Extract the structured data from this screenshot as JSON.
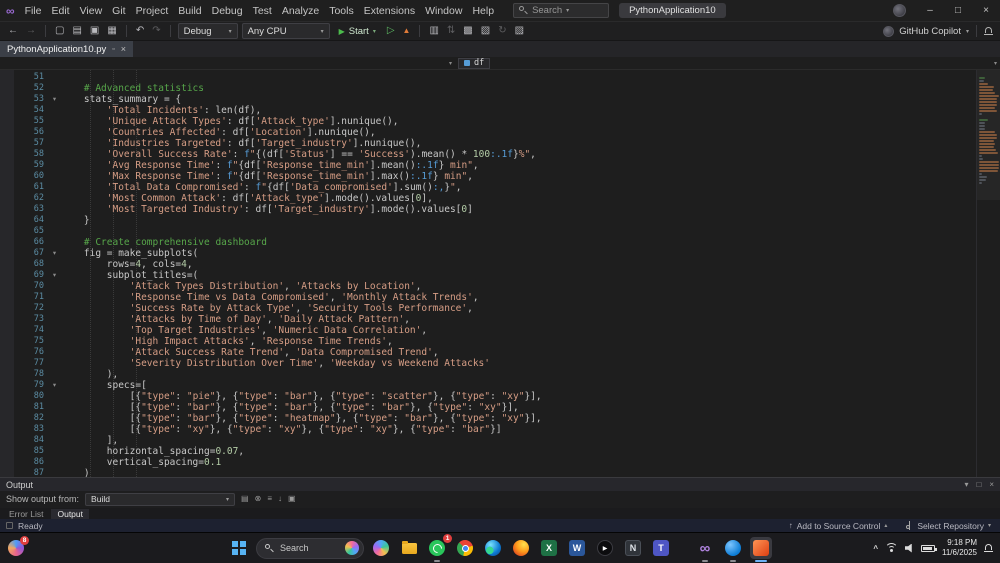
{
  "window": {
    "menu": [
      "File",
      "Edit",
      "View",
      "Git",
      "Project",
      "Build",
      "Debug",
      "Test",
      "Analyze",
      "Tools",
      "Extensions",
      "Window",
      "Help"
    ],
    "search_label": "Search",
    "title": "PythonApplication10"
  },
  "toolbar": {
    "config": "Debug",
    "platform": "Any CPU",
    "start": "Start",
    "copilot": "GitHub Copilot"
  },
  "tabbar": {
    "active_tab": "PythonApplication10.py"
  },
  "navbar": {
    "symbol": "df"
  },
  "editor": {
    "lines": [
      {
        "no": 51,
        "t": []
      },
      {
        "no": 52,
        "t": [
          [
            "p",
            "    "
          ],
          [
            "c",
            "# Advanced statistics"
          ]
        ]
      },
      {
        "no": 53,
        "fold": true,
        "t": [
          [
            "p",
            "    stats_summary = {"
          ]
        ]
      },
      {
        "no": 54,
        "t": [
          [
            "p",
            "        "
          ],
          [
            "s",
            "'Total Incidents'"
          ],
          [
            "p",
            ": len(df),"
          ]
        ]
      },
      {
        "no": 55,
        "t": [
          [
            "p",
            "        "
          ],
          [
            "s",
            "'Unique Attack Types'"
          ],
          [
            "p",
            ": df["
          ],
          [
            "s",
            "'Attack_type'"
          ],
          [
            "p",
            "].nunique(),"
          ]
        ]
      },
      {
        "no": 56,
        "t": [
          [
            "p",
            "        "
          ],
          [
            "s",
            "'Countries Affected'"
          ],
          [
            "p",
            ": df["
          ],
          [
            "s",
            "'Location'"
          ],
          [
            "p",
            "].nunique(),"
          ]
        ]
      },
      {
        "no": 57,
        "t": [
          [
            "p",
            "        "
          ],
          [
            "s",
            "'Industries Targeted'"
          ],
          [
            "p",
            ": df["
          ],
          [
            "s",
            "'Target_industry'"
          ],
          [
            "p",
            "].nunique(),"
          ]
        ]
      },
      {
        "no": 58,
        "t": [
          [
            "p",
            "        "
          ],
          [
            "s",
            "'Overall Success Rate'"
          ],
          [
            "p",
            ": "
          ],
          [
            "k",
            "f"
          ],
          [
            "s",
            "\""
          ],
          [
            "p",
            "{(df["
          ],
          [
            "s",
            "'Status'"
          ],
          [
            "p",
            "] == "
          ],
          [
            "s",
            "'Success'"
          ],
          [
            "p",
            ").mean() * "
          ],
          [
            "n",
            "100"
          ],
          [
            "f",
            ":.1f"
          ],
          [
            "p",
            "}"
          ],
          [
            "s",
            "%\""
          ],
          [
            "p",
            ","
          ]
        ]
      },
      {
        "no": 59,
        "t": [
          [
            "p",
            "        "
          ],
          [
            "s",
            "'Avg Response Time'"
          ],
          [
            "p",
            ": "
          ],
          [
            "k",
            "f"
          ],
          [
            "s",
            "\""
          ],
          [
            "p",
            "{df["
          ],
          [
            "s",
            "'Response_time_min'"
          ],
          [
            "p",
            "].mean()"
          ],
          [
            "f",
            ":.1f"
          ],
          [
            "p",
            "}"
          ],
          [
            "s",
            " min\""
          ],
          [
            "p",
            ","
          ]
        ]
      },
      {
        "no": 60,
        "t": [
          [
            "p",
            "        "
          ],
          [
            "s",
            "'Max Response Time'"
          ],
          [
            "p",
            ": "
          ],
          [
            "k",
            "f"
          ],
          [
            "s",
            "\""
          ],
          [
            "p",
            "{df["
          ],
          [
            "s",
            "'Response_time_min'"
          ],
          [
            "p",
            "].max()"
          ],
          [
            "f",
            ":.1f"
          ],
          [
            "p",
            "}"
          ],
          [
            "s",
            " min\""
          ],
          [
            "p",
            ","
          ]
        ]
      },
      {
        "no": 61,
        "t": [
          [
            "p",
            "        "
          ],
          [
            "s",
            "'Total Data Compromised'"
          ],
          [
            "p",
            ": "
          ],
          [
            "k",
            "f"
          ],
          [
            "s",
            "\""
          ],
          [
            "p",
            "{df["
          ],
          [
            "s",
            "'Data_compromised'"
          ],
          [
            "p",
            "].sum()"
          ],
          [
            "f",
            ":,"
          ],
          [
            "p",
            "}"
          ],
          [
            "s",
            "\""
          ],
          [
            "p",
            ","
          ]
        ]
      },
      {
        "no": 62,
        "t": [
          [
            "p",
            "        "
          ],
          [
            "s",
            "'Most Common Attack'"
          ],
          [
            "p",
            ": df["
          ],
          [
            "s",
            "'Attack_type'"
          ],
          [
            "p",
            "].mode().values["
          ],
          [
            "n",
            "0"
          ],
          [
            "p",
            "],"
          ]
        ]
      },
      {
        "no": 63,
        "t": [
          [
            "p",
            "        "
          ],
          [
            "s",
            "'Most Targeted Industry'"
          ],
          [
            "p",
            ": df["
          ],
          [
            "s",
            "'Target_industry'"
          ],
          [
            "p",
            "].mode().values["
          ],
          [
            "n",
            "0"
          ],
          [
            "p",
            "]"
          ]
        ]
      },
      {
        "no": 64,
        "t": [
          [
            "p",
            "    }"
          ]
        ]
      },
      {
        "no": 65,
        "t": []
      },
      {
        "no": 66,
        "t": [
          [
            "p",
            "    "
          ],
          [
            "c",
            "# Create comprehensive dashboard"
          ]
        ]
      },
      {
        "no": 67,
        "fold": true,
        "t": [
          [
            "p",
            "    fig = make_subplots("
          ]
        ]
      },
      {
        "no": 68,
        "t": [
          [
            "p",
            "        rows="
          ],
          [
            "n",
            "4"
          ],
          [
            "p",
            ", cols="
          ],
          [
            "n",
            "4"
          ],
          [
            "p",
            ","
          ]
        ]
      },
      {
        "no": 69,
        "fold": true,
        "t": [
          [
            "p",
            "        subplot_titles=("
          ]
        ]
      },
      {
        "no": 70,
        "t": [
          [
            "p",
            "            "
          ],
          [
            "s",
            "'Attack Types Distribution'"
          ],
          [
            "p",
            ", "
          ],
          [
            "s",
            "'Attacks by Location'"
          ],
          [
            "p",
            ","
          ]
        ]
      },
      {
        "no": 71,
        "t": [
          [
            "p",
            "            "
          ],
          [
            "s",
            "'Response Time vs Data Compromised'"
          ],
          [
            "p",
            ", "
          ],
          [
            "s",
            "'Monthly Attack Trends'"
          ],
          [
            "p",
            ","
          ]
        ]
      },
      {
        "no": 72,
        "t": [
          [
            "p",
            "            "
          ],
          [
            "s",
            "'Success Rate by Attack Type'"
          ],
          [
            "p",
            ", "
          ],
          [
            "s",
            "'Security Tools Performance'"
          ],
          [
            "p",
            ","
          ]
        ]
      },
      {
        "no": 73,
        "t": [
          [
            "p",
            "            "
          ],
          [
            "s",
            "'Attacks by Time of Day'"
          ],
          [
            "p",
            ", "
          ],
          [
            "s",
            "'Daily Attack Pattern'"
          ],
          [
            "p",
            ","
          ]
        ]
      },
      {
        "no": 74,
        "t": [
          [
            "p",
            "            "
          ],
          [
            "s",
            "'Top Target Industries'"
          ],
          [
            "p",
            ", "
          ],
          [
            "s",
            "'Numeric Data Correlation'"
          ],
          [
            "p",
            ","
          ]
        ]
      },
      {
        "no": 75,
        "t": [
          [
            "p",
            "            "
          ],
          [
            "s",
            "'High Impact Attacks'"
          ],
          [
            "p",
            ", "
          ],
          [
            "s",
            "'Response Time Trends'"
          ],
          [
            "p",
            ","
          ]
        ]
      },
      {
        "no": 76,
        "t": [
          [
            "p",
            "            "
          ],
          [
            "s",
            "'Attack Success Rate Trend'"
          ],
          [
            "p",
            ", "
          ],
          [
            "s",
            "'Data Compromised Trend'"
          ],
          [
            "p",
            ","
          ]
        ]
      },
      {
        "no": 77,
        "t": [
          [
            "p",
            "            "
          ],
          [
            "s",
            "'Severity Distribution Over Time'"
          ],
          [
            "p",
            ", "
          ],
          [
            "s",
            "'Weekday vs Weekend Attacks'"
          ]
        ]
      },
      {
        "no": 78,
        "t": [
          [
            "p",
            "        ),"
          ]
        ]
      },
      {
        "no": 79,
        "fold": true,
        "t": [
          [
            "p",
            "        specs=["
          ]
        ]
      },
      {
        "no": 80,
        "t": [
          [
            "p",
            "            [{"
          ],
          [
            "s",
            "\"type\""
          ],
          [
            "p",
            ": "
          ],
          [
            "s",
            "\"pie\""
          ],
          [
            "p",
            "}, {"
          ],
          [
            "s",
            "\"type\""
          ],
          [
            "p",
            ": "
          ],
          [
            "s",
            "\"bar\""
          ],
          [
            "p",
            "}, {"
          ],
          [
            "s",
            "\"type\""
          ],
          [
            "p",
            ": "
          ],
          [
            "s",
            "\"scatter\""
          ],
          [
            "p",
            "}, {"
          ],
          [
            "s",
            "\"type\""
          ],
          [
            "p",
            ": "
          ],
          [
            "s",
            "\"xy\""
          ],
          [
            "p",
            "}],"
          ]
        ]
      },
      {
        "no": 81,
        "t": [
          [
            "p",
            "            [{"
          ],
          [
            "s",
            "\"type\""
          ],
          [
            "p",
            ": "
          ],
          [
            "s",
            "\"bar\""
          ],
          [
            "p",
            "}, {"
          ],
          [
            "s",
            "\"type\""
          ],
          [
            "p",
            ": "
          ],
          [
            "s",
            "\"bar\""
          ],
          [
            "p",
            "}, {"
          ],
          [
            "s",
            "\"type\""
          ],
          [
            "p",
            ": "
          ],
          [
            "s",
            "\"bar\""
          ],
          [
            "p",
            "}, {"
          ],
          [
            "s",
            "\"type\""
          ],
          [
            "p",
            ": "
          ],
          [
            "s",
            "\"xy\""
          ],
          [
            "p",
            "}],"
          ]
        ]
      },
      {
        "no": 82,
        "t": [
          [
            "p",
            "            [{"
          ],
          [
            "s",
            "\"type\""
          ],
          [
            "p",
            ": "
          ],
          [
            "s",
            "\"bar\""
          ],
          [
            "p",
            "}, {"
          ],
          [
            "s",
            "\"type\""
          ],
          [
            "p",
            ": "
          ],
          [
            "s",
            "\"heatmap\""
          ],
          [
            "p",
            "}, {"
          ],
          [
            "s",
            "\"type\""
          ],
          [
            "p",
            ": "
          ],
          [
            "s",
            "\"bar\""
          ],
          [
            "p",
            "}, {"
          ],
          [
            "s",
            "\"type\""
          ],
          [
            "p",
            ": "
          ],
          [
            "s",
            "\"xy\""
          ],
          [
            "p",
            "}],"
          ]
        ]
      },
      {
        "no": 83,
        "t": [
          [
            "p",
            "            [{"
          ],
          [
            "s",
            "\"type\""
          ],
          [
            "p",
            ": "
          ],
          [
            "s",
            "\"xy\""
          ],
          [
            "p",
            "}, {"
          ],
          [
            "s",
            "\"type\""
          ],
          [
            "p",
            ": "
          ],
          [
            "s",
            "\"xy\""
          ],
          [
            "p",
            "}, {"
          ],
          [
            "s",
            "\"type\""
          ],
          [
            "p",
            ": "
          ],
          [
            "s",
            "\"xy\""
          ],
          [
            "p",
            "}, {"
          ],
          [
            "s",
            "\"type\""
          ],
          [
            "p",
            ": "
          ],
          [
            "s",
            "\"bar\""
          ],
          [
            "p",
            "}]"
          ]
        ]
      },
      {
        "no": 84,
        "t": [
          [
            "p",
            "        ],"
          ]
        ]
      },
      {
        "no": 85,
        "t": [
          [
            "p",
            "        horizontal_spacing="
          ],
          [
            "n",
            "0.07"
          ],
          [
            "p",
            ","
          ]
        ]
      },
      {
        "no": 86,
        "t": [
          [
            "p",
            "        vertical_spacing="
          ],
          [
            "n",
            "0.1"
          ]
        ]
      },
      {
        "no": 87,
        "t": [
          [
            "p",
            "    )"
          ]
        ]
      }
    ]
  },
  "output": {
    "title": "Output",
    "show_from": "Show output from:",
    "source": "Build",
    "tabs": [
      "Error List",
      "Output"
    ]
  },
  "status": {
    "ready": "Ready",
    "add_source_control": "Add to Source Control",
    "select_repository": "Select Repository"
  },
  "taskbar": {
    "search": "Search",
    "corner_badge": "8",
    "whatsapp_badge": "1",
    "time": "9:18 PM",
    "date": "11/6/2025"
  }
}
